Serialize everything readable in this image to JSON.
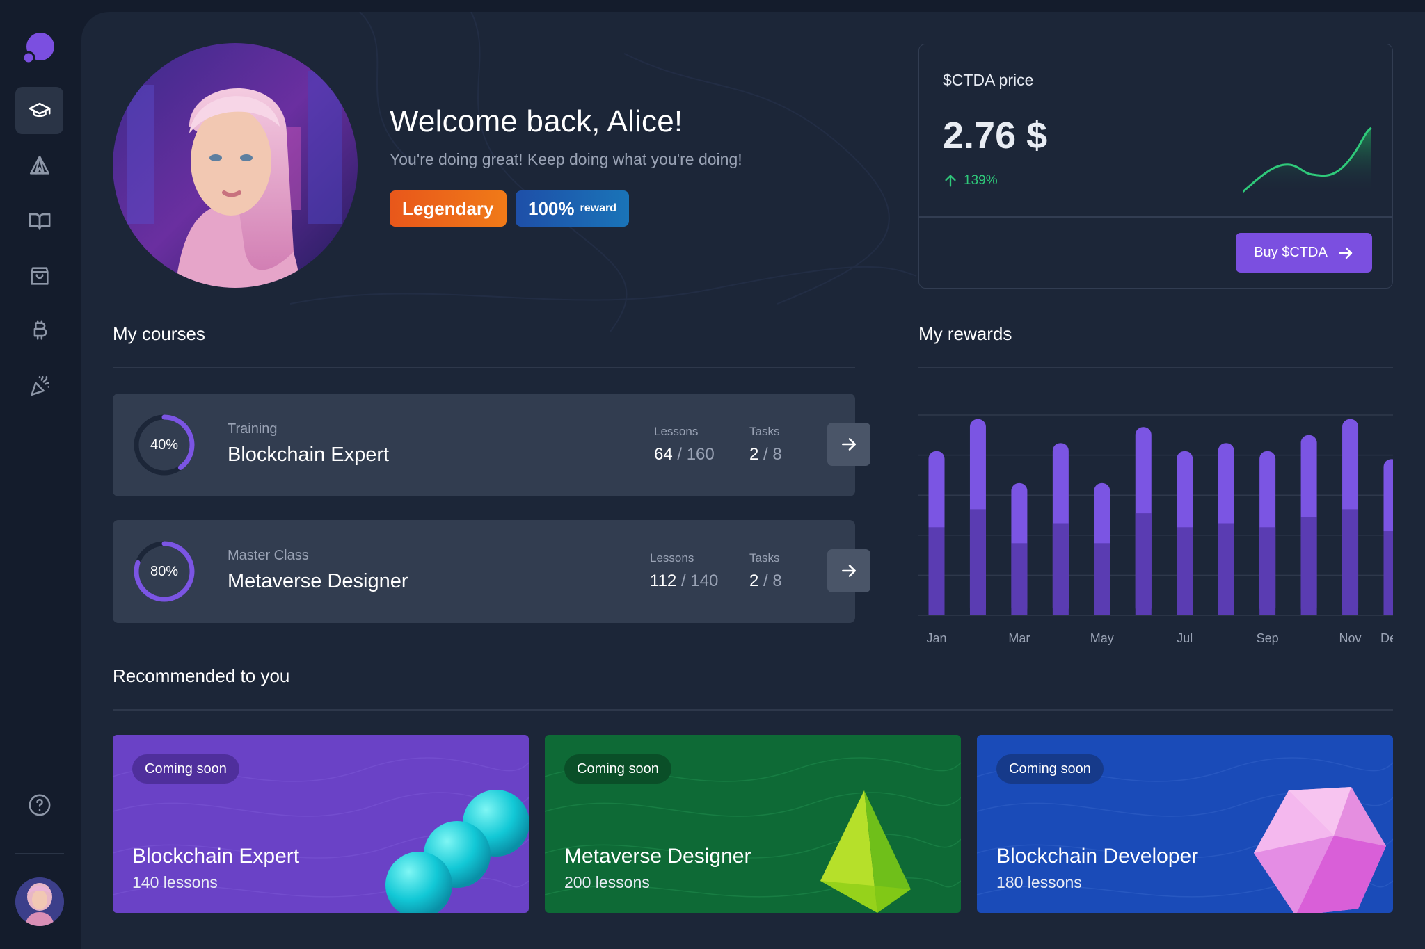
{
  "sidebar": {
    "items": [
      {
        "icon": "graduation-cap-icon",
        "active": true
      },
      {
        "icon": "tent-icon",
        "active": false
      },
      {
        "icon": "book-icon",
        "active": false
      },
      {
        "icon": "shopping-bag-icon",
        "active": false
      },
      {
        "icon": "bitcoin-icon",
        "active": false
      },
      {
        "icon": "party-popper-icon",
        "active": false
      }
    ],
    "help_icon": "help-circle-icon"
  },
  "profile": {
    "welcome": "Welcome back, Alice!",
    "subtitle": "You're doing great! Keep doing what you're doing!",
    "badge_level": "Legendary",
    "badge_reward_value": "100%",
    "badge_reward_label": "reward"
  },
  "price": {
    "label": "$CTDA price",
    "value": "2.76 $",
    "change": "139%",
    "buy_label": "Buy $CTDA",
    "accent": "#7b4fe0",
    "positive_color": "#2fc97a"
  },
  "courses": {
    "title": "My courses",
    "lessons_label": "Lessons",
    "tasks_label": "Tasks",
    "items": [
      {
        "progress_text": "40%",
        "progress": 0.4,
        "kind": "Training",
        "name": "Blockchain Expert",
        "lessons_done": "64",
        "lessons_total": "/ 160",
        "tasks_done": "2",
        "tasks_total": "/ 8"
      },
      {
        "progress_text": "80%",
        "progress": 0.8,
        "kind": "Master Class",
        "name": "Metaverse Designer",
        "lessons_done": "112",
        "lessons_total": "/ 140",
        "tasks_done": "2",
        "tasks_total": "/ 8"
      }
    ]
  },
  "rewards": {
    "title": "My rewards"
  },
  "chart_data": {
    "type": "bar",
    "categories": [
      "Jan",
      "Feb",
      "Mar",
      "Apr",
      "May",
      "Jun",
      "Jul",
      "Aug",
      "Sep",
      "Oct",
      "Nov",
      "Dec"
    ],
    "tick_labels": [
      "Jan",
      "",
      "Mar",
      "",
      "May",
      "",
      "Jul",
      "",
      "Sep",
      "",
      "Nov",
      "Dec"
    ],
    "series": [
      {
        "values": [
          82,
          98,
          66,
          86,
          66,
          94,
          82,
          86,
          82,
          90,
          98,
          78
        ]
      },
      {
        "values": [
          44,
          53,
          36,
          46,
          36,
          51,
          44,
          46,
          44,
          49,
          53,
          42
        ]
      }
    ],
    "ylim": [
      0,
      100
    ],
    "grid": true,
    "colors": [
      "#7b55e3",
      "#5a3cb2"
    ]
  },
  "recommended": {
    "title": "Recommended to you",
    "items": [
      {
        "pill": "Coming soon",
        "name": "Blockchain Expert",
        "lessons": "140 lessons",
        "color": "#6a42c6"
      },
      {
        "pill": "Coming soon",
        "name": "Metaverse Designer",
        "lessons": "200 lessons",
        "color": "#0e6a36"
      },
      {
        "pill": "Coming soon",
        "name": "Blockchain Developer",
        "lessons": "180 lessons",
        "color": "#1a4bb8"
      }
    ]
  }
}
